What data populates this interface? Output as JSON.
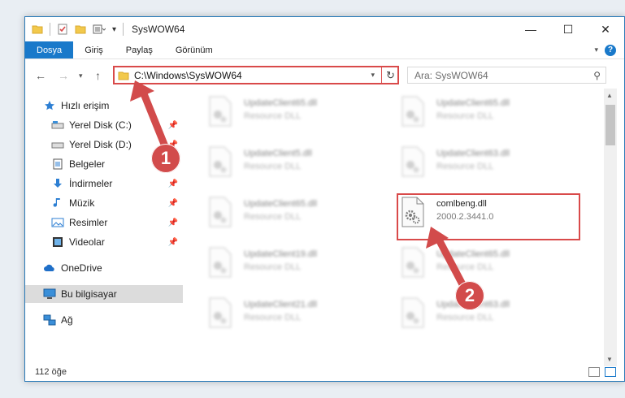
{
  "window": {
    "title": "SysWOW64",
    "controls": {
      "minimize": "—",
      "maximize": "☐",
      "close": "✕"
    }
  },
  "ribbon": {
    "tabs": [
      {
        "label": "Dosya",
        "active": true
      },
      {
        "label": "Giriş"
      },
      {
        "label": "Paylaş"
      },
      {
        "label": "Görünüm"
      }
    ],
    "help": "?"
  },
  "nav": {
    "address_path": "C:\\Windows\\SysWOW64",
    "search_placeholder": "Ara: SysWOW64"
  },
  "sidebar": {
    "items": [
      {
        "label": "Hızlı erişim",
        "icon": "star-icon"
      },
      {
        "label": "Yerel Disk (C:)",
        "icon": "drive-icon",
        "pinned": true
      },
      {
        "label": "Yerel Disk (D:)",
        "icon": "drive-icon",
        "pinned": true
      },
      {
        "label": "Belgeler",
        "icon": "documents-icon",
        "pinned": true
      },
      {
        "label": "İndirmeler",
        "icon": "download-icon",
        "pinned": true
      },
      {
        "label": "Müzik",
        "icon": "music-icon",
        "pinned": true
      },
      {
        "label": "Resimler",
        "icon": "pictures-icon",
        "pinned": true
      },
      {
        "label": "Videolar",
        "icon": "videos-icon",
        "pinned": true
      },
      {
        "label": "OneDrive",
        "icon": "cloud-icon"
      },
      {
        "label": "Bu bilgisayar",
        "icon": "computer-icon",
        "selected": true
      },
      {
        "label": "Ağ",
        "icon": "network-icon"
      }
    ]
  },
  "files": [
    {
      "name": "UpdateClient65.dll",
      "desc": "Resource DLL"
    },
    {
      "name": "UpdateClient65.dll",
      "desc": "Resource DLL"
    },
    {
      "name": "UpdateClient5.dll",
      "desc": "Resource DLL"
    },
    {
      "name": "UpdateClient63.dll",
      "desc": "Resource DLL"
    },
    {
      "name": "UpdateClient65.dll",
      "desc": "Resource DLL"
    },
    {
      "name": "comlbeng.dll",
      "desc": "2000.2.3441.0",
      "highlighted": true
    },
    {
      "name": "UpdateClient19.dll",
      "desc": "Resource DLL"
    },
    {
      "name": "UpdateClient65.dll",
      "desc": "Resource DLL"
    },
    {
      "name": "UpdateClient21.dll",
      "desc": "Resource DLL"
    },
    {
      "name": "UpdateClient63.dll",
      "desc": "Resource DLL"
    }
  ],
  "status": {
    "item_count": "112 öğe"
  },
  "callouts": {
    "step1": "1",
    "step2": "2"
  },
  "colors": {
    "accent": "#1979ca",
    "callout": "#d24b4b"
  }
}
